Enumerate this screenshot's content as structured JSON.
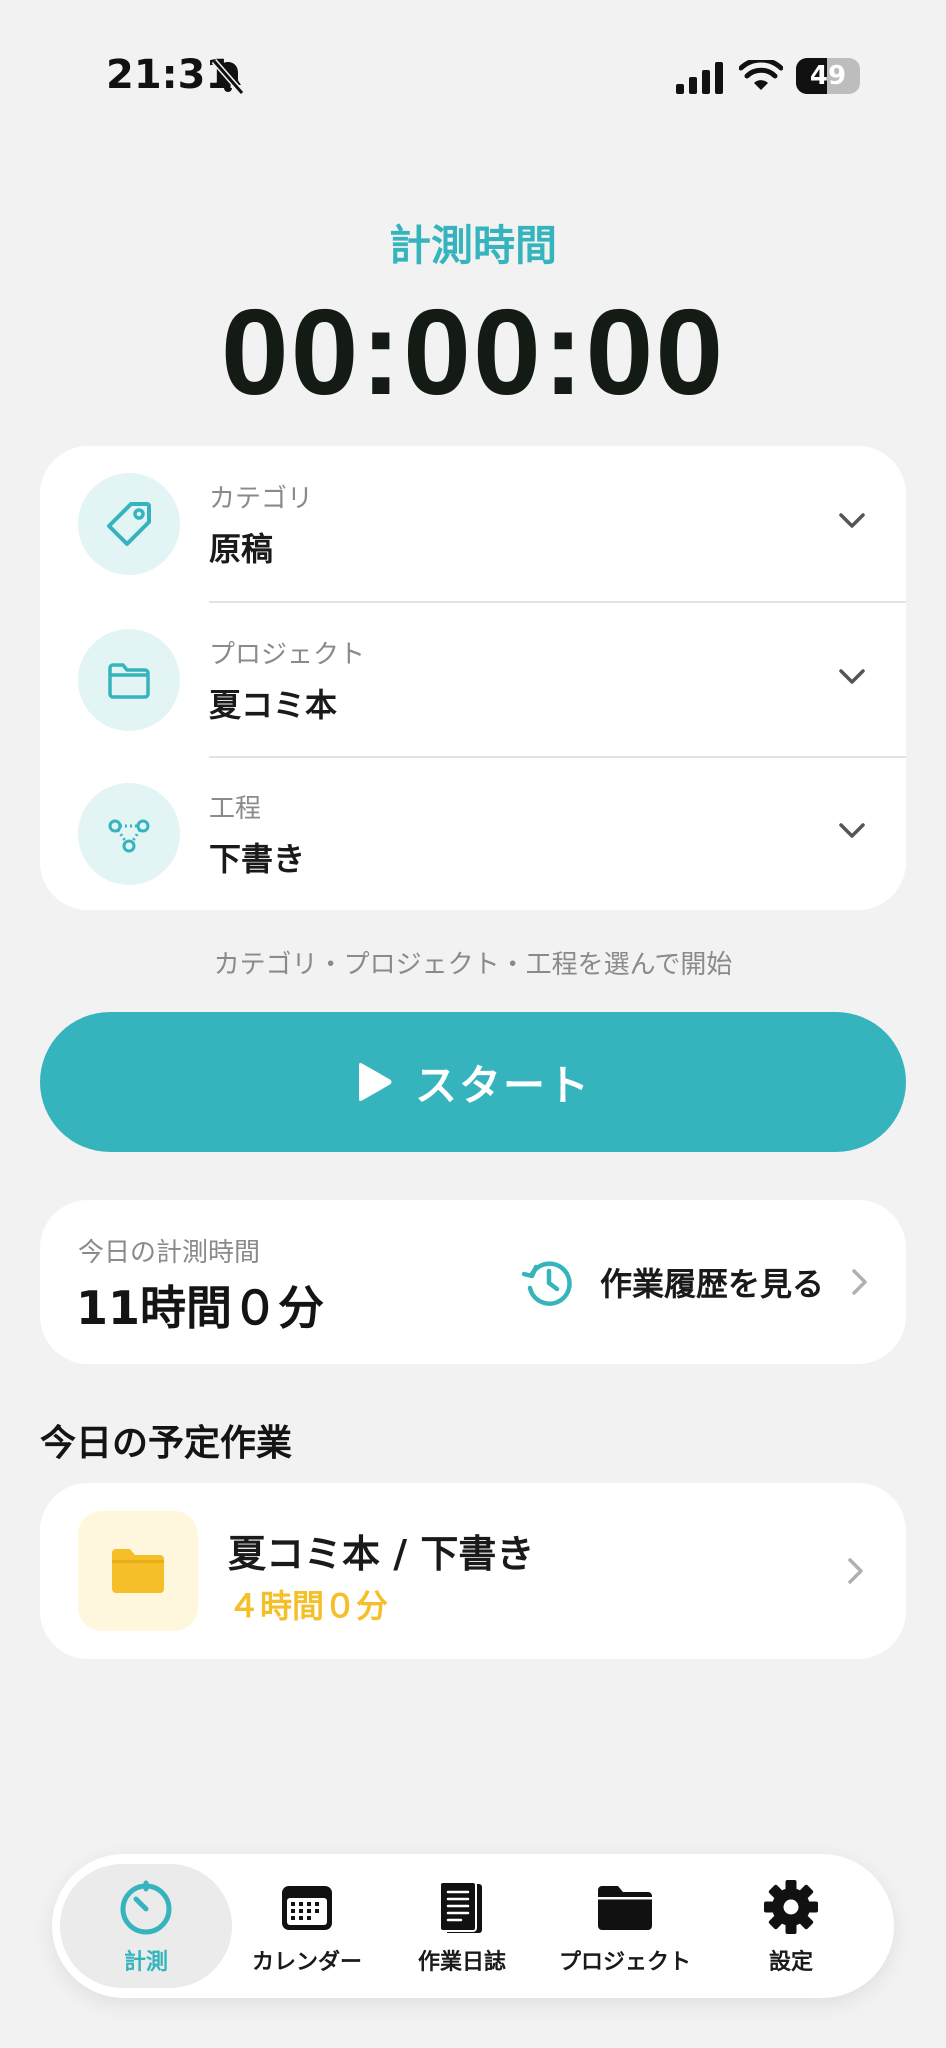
{
  "status_bar": {
    "time": "21:31",
    "battery": "49",
    "battery_level_percent": 49
  },
  "timer": {
    "label": "計測時間",
    "value": "00:00:00"
  },
  "selectors": [
    {
      "label": "カテゴリ",
      "value": "原稿",
      "icon": "tag-icon"
    },
    {
      "label": "プロジェクト",
      "value": "夏コミ本",
      "icon": "folder-icon"
    },
    {
      "label": "工程",
      "value": "下書き",
      "icon": "process-nodes-icon"
    }
  ],
  "hint": "カテゴリ・プロジェクト・工程を選んで開始",
  "start_button": {
    "label": "スタート",
    "icon": "play-icon"
  },
  "today": {
    "label": "今日の計測時間",
    "value": "11時間０分",
    "history_link": "作業履歴を見る"
  },
  "scheduled": {
    "title": "今日の予定作業",
    "items": [
      {
        "title": "夏コミ本 / 下書き",
        "duration": "４時間０分",
        "icon": "folder-icon"
      }
    ]
  },
  "tabs": [
    {
      "label": "計測",
      "icon": "timer-icon",
      "active": true
    },
    {
      "label": "カレンダー",
      "icon": "calendar-icon",
      "active": false
    },
    {
      "label": "作業日誌",
      "icon": "notebook-icon",
      "active": false
    },
    {
      "label": "プロジェクト",
      "icon": "folder-icon",
      "active": false
    },
    {
      "label": "設定",
      "icon": "gear-icon",
      "active": false
    }
  ],
  "colors": {
    "accent": "#36b4bd",
    "accent_light": "#e3f4f5",
    "warning": "#f5bf2a",
    "background": "#f2f2f2"
  }
}
